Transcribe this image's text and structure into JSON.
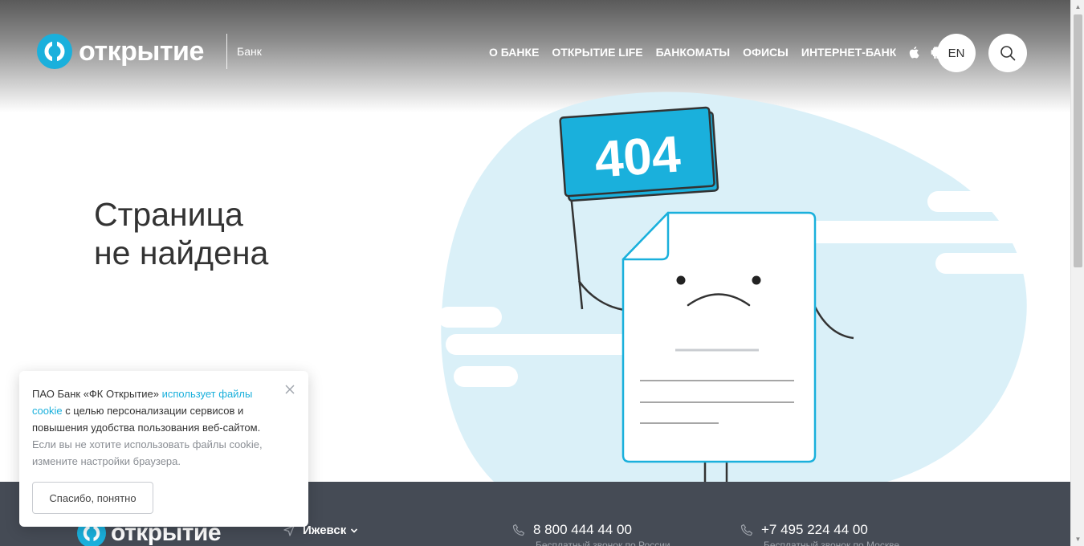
{
  "header": {
    "logo_text": "открытие",
    "logo_sub": "Банк",
    "nav": [
      "О БАНКЕ",
      "ОТКРЫТИЕ LIFE",
      "БАНКОМАТЫ",
      "ОФИСЫ",
      "ИНТЕРНЕТ-БАНК"
    ],
    "os_icons": [
      "apple-icon",
      "android-icon"
    ],
    "lang_label": "EN",
    "search_icon": "search-icon"
  },
  "main": {
    "title_line1": "Страница",
    "title_line2": "не найдена",
    "flag_text": "404"
  },
  "footer": {
    "logo_text": "открытие",
    "city": "Ижевск",
    "phone1": "8 800 444 44 00",
    "phone1_sub": "Бесплатный звонок по России",
    "phone2": "+7 495 224 44 00",
    "phone2_sub": "Бесплатный звонок по Москве"
  },
  "cookie": {
    "text_prefix": "ПАО Банк «ФК Открытие» ",
    "link_text": "использует файлы cookie",
    "text_suffix": " с целью персонализации сервисов и повышения удобства пользования веб-сайтом.",
    "muted_text": "Если вы не хотите использовать файлы cookie, измените настройки браузера.",
    "button_label": "Спасибо, понятно"
  },
  "colors": {
    "accent": "#1ab0dc",
    "footer_bg": "#454b55",
    "blob": "#daf0f8"
  }
}
